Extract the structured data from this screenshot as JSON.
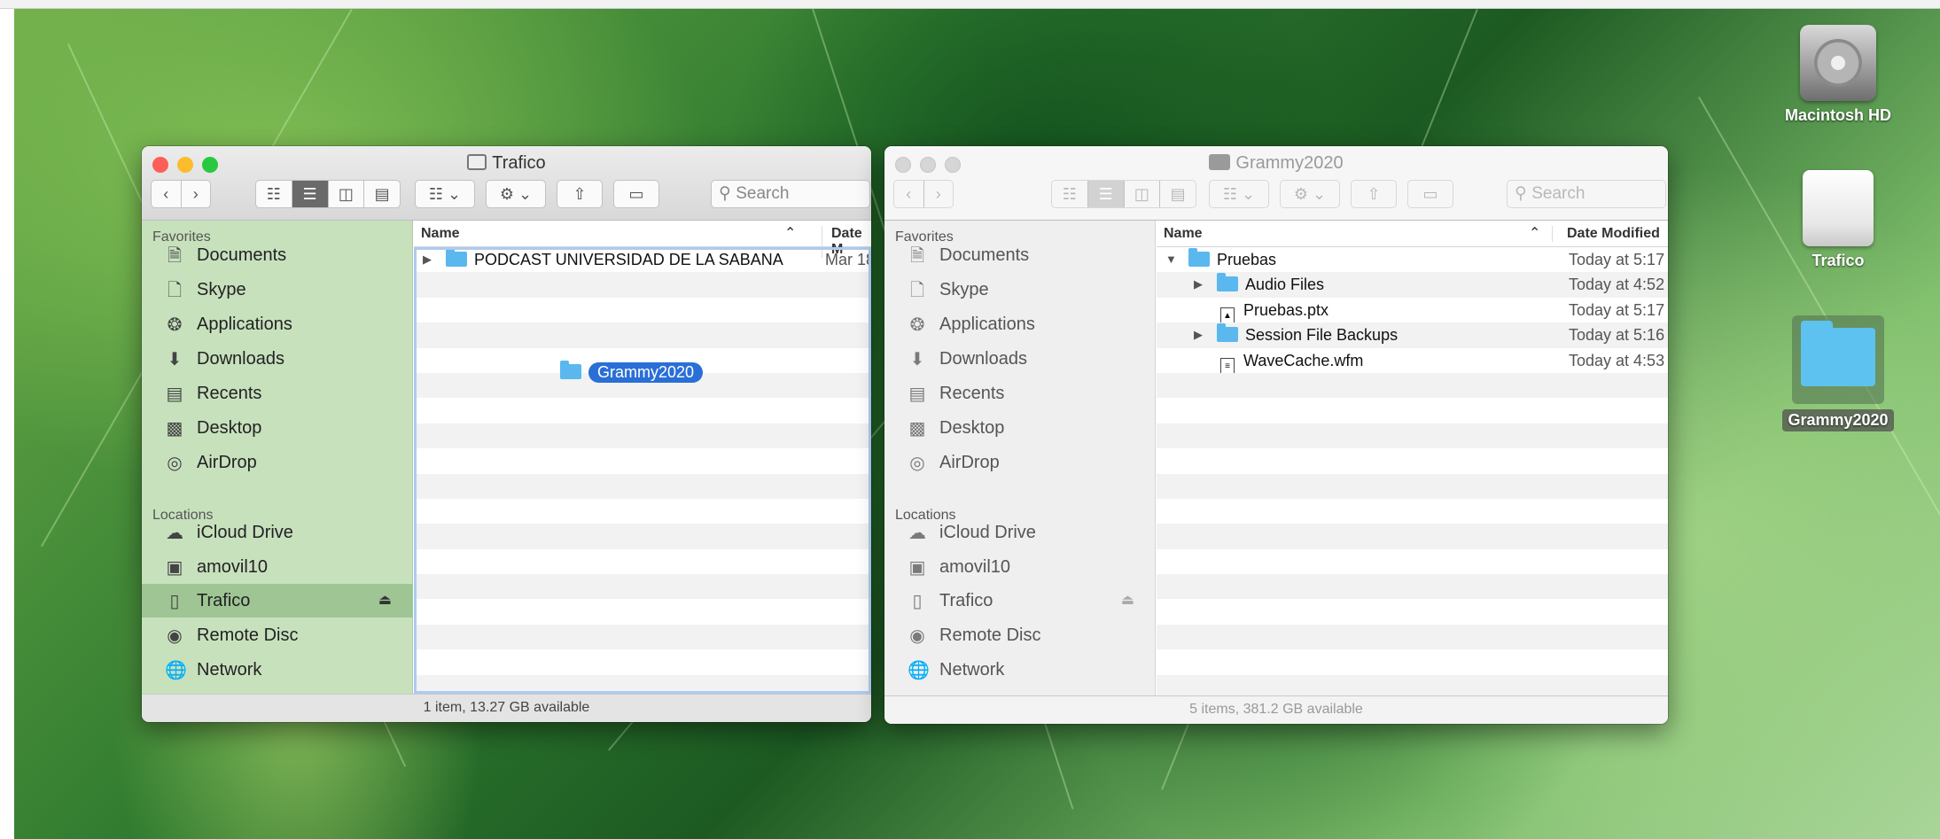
{
  "desktop": {
    "icons": [
      {
        "label": "Macintosh HD"
      },
      {
        "label": "Trafico"
      },
      {
        "label": "Grammy2020"
      }
    ]
  },
  "left_window": {
    "title": "Trafico",
    "search_placeholder": "Search",
    "sidebar": {
      "favorites_heading": "Favorites",
      "favorites": [
        {
          "label": "Documents",
          "icon": "documents-icon"
        },
        {
          "label": "Skype",
          "icon": "document-icon"
        },
        {
          "label": "Applications",
          "icon": "applications-icon"
        },
        {
          "label": "Downloads",
          "icon": "downloads-icon"
        },
        {
          "label": "Recents",
          "icon": "recents-icon"
        },
        {
          "label": "Desktop",
          "icon": "desktop-icon"
        },
        {
          "label": "AirDrop",
          "icon": "airdrop-icon"
        }
      ],
      "locations_heading": "Locations",
      "locations": [
        {
          "label": "iCloud Drive",
          "icon": "cloud-icon"
        },
        {
          "label": "amovil10",
          "icon": "laptop-icon"
        },
        {
          "label": "Trafico",
          "icon": "drive-icon",
          "selected": true
        },
        {
          "label": "Remote Disc",
          "icon": "disc-icon"
        },
        {
          "label": "Network",
          "icon": "network-icon"
        }
      ]
    },
    "columns": {
      "name": "Name",
      "date": "Date M"
    },
    "rows": [
      {
        "name": "PODCAST UNIVERSIDAD DE LA SABANA",
        "date": "Mar 18"
      }
    ],
    "drag_item": "Grammy2020",
    "status": "1 item, 13.27 GB available"
  },
  "right_window": {
    "title": "Grammy2020",
    "search_placeholder": "Search",
    "sidebar": {
      "favorites_heading": "Favorites",
      "favorites": [
        {
          "label": "Documents"
        },
        {
          "label": "Skype"
        },
        {
          "label": "Applications"
        },
        {
          "label": "Downloads"
        },
        {
          "label": "Recents"
        },
        {
          "label": "Desktop"
        },
        {
          "label": "AirDrop"
        }
      ],
      "locations_heading": "Locations",
      "locations": [
        {
          "label": "iCloud Drive"
        },
        {
          "label": "amovil10"
        },
        {
          "label": "Trafico"
        },
        {
          "label": "Remote Disc"
        },
        {
          "label": "Network"
        }
      ]
    },
    "columns": {
      "name": "Name",
      "date": "Date Modified"
    },
    "rows": [
      {
        "name": "Pruebas",
        "date": "Today at 5:17",
        "type": "folder",
        "expanded": true
      },
      {
        "name": "Audio Files",
        "date": "Today at 4:52",
        "type": "folder"
      },
      {
        "name": "Pruebas.ptx",
        "date": "Today at 5:17",
        "type": "file"
      },
      {
        "name": "Session File Backups",
        "date": "Today at 5:16",
        "type": "folder"
      },
      {
        "name": "WaveCache.wfm",
        "date": "Today at 4:53",
        "type": "file"
      }
    ],
    "status": "5 items, 381.2 GB available"
  }
}
